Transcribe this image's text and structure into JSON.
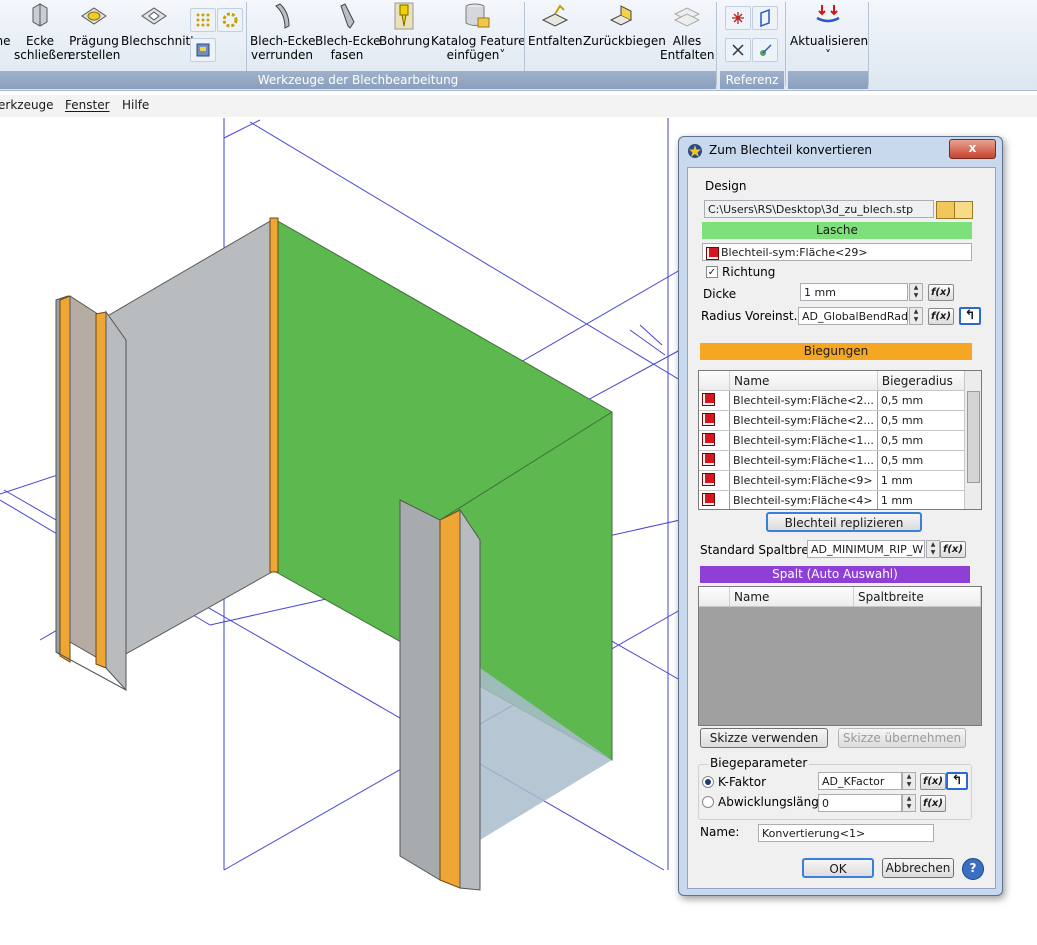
{
  "ribbon": {
    "buttons": [
      {
        "label": "he",
        "x": 0
      },
      {
        "label": "Ecke\nschließen"
      },
      {
        "label": "Prägung\nerstellen"
      },
      {
        "label": "Blechschnitt"
      },
      {
        "label": "Blech-Ecke\nverrunden"
      },
      {
        "label": "Blech-Ecke\nfasen"
      },
      {
        "label": "Bohrung"
      },
      {
        "label": "Katalog Feature\neinfügen˅"
      },
      {
        "label": "Entfalten"
      },
      {
        "label": "Zurückbiegen"
      },
      {
        "label": "Alles\nEntfalten"
      },
      {
        "label": "Aktualisieren\n˅"
      }
    ],
    "group_tools": "Werkzeuge der Blechbearbeitung",
    "group_reference": "Referenz"
  },
  "menubar": {
    "items": [
      "erkzeuge",
      "Fenster",
      "Hilfe"
    ]
  },
  "dialog": {
    "title": "Zum Blechteil konvertieren",
    "close": "x",
    "design_label": "Design",
    "design_path": "C:\\Users\\RS\\Desktop\\3d_zu_blech.stp",
    "lasche_band": "Lasche",
    "lasche_face": "Blechteil-sym:Fläche<29>",
    "richtung_label": "Richtung",
    "richtung_checked": "✓",
    "dicke_label": "Dicke",
    "dicke_value": "1 mm",
    "radius_label": "Radius Voreinst.",
    "radius_value": "AD_GlobalBendRadius",
    "biegungen_band": "Biegungen",
    "bend_headers": [
      "Name",
      "Biegeradius"
    ],
    "bends": [
      {
        "name": "Blechteil-sym:Fläche<2...",
        "radius": "0,5 mm"
      },
      {
        "name": "Blechteil-sym:Fläche<2...",
        "radius": "0,5 mm"
      },
      {
        "name": "Blechteil-sym:Fläche<1...",
        "radius": "0,5 mm"
      },
      {
        "name": "Blechteil-sym:Fläche<1...",
        "radius": "0,5 mm"
      },
      {
        "name": "Blechteil-sym:Fläche<9>",
        "radius": "1 mm"
      },
      {
        "name": "Blechteil-sym:Fläche<4>",
        "radius": "1 mm"
      }
    ],
    "replicate_button": "Blechteil replizieren",
    "spalt_label": "Standard Spaltbreite",
    "spalt_value": "AD_MINIMUM_RIP_WIDTH",
    "spalt_band": "Spalt (Auto Auswahl)",
    "gap_headers": [
      "Name",
      "Spaltbreite"
    ],
    "sketch_use": "Skizze verwenden",
    "sketch_take": "Skizze übernehmen",
    "bend_params_label": "Biegeparameter",
    "kfactor_label": "K-Faktor",
    "kfactor_value": "AD_KFactor",
    "unfold_label": "Abwicklungslänge",
    "unfold_value": "0",
    "name_label": "Name:",
    "name_value": "Konvertierung<1>",
    "ok": "OK",
    "cancel": "Abbrechen",
    "help": "?",
    "fx": "f(x)"
  },
  "colors": {
    "lasche": "#7ee07a",
    "biegungen": "#f5a623",
    "spalt": "#8e3fd6",
    "model_green": "#5db84f",
    "model_gray": "#b9bcbe",
    "construction_lines": "#3f3fd0"
  }
}
